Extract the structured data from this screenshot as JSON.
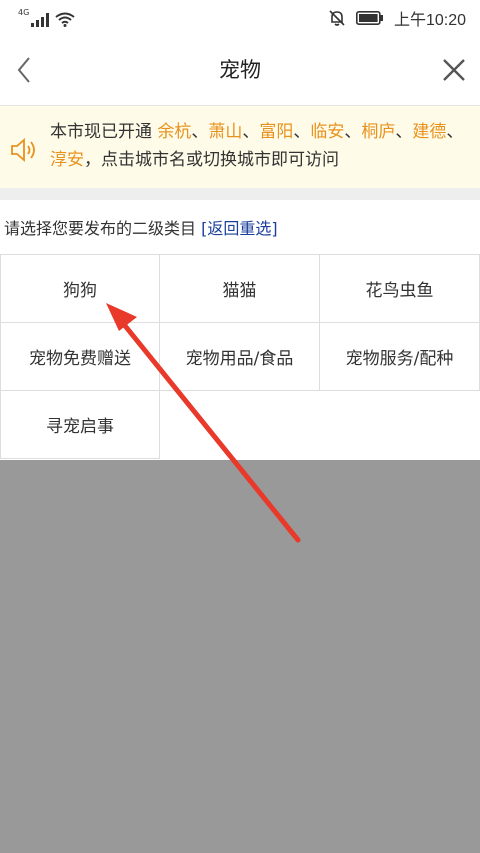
{
  "status_bar": {
    "network": "4G",
    "time": "上午10:20"
  },
  "nav": {
    "title": "宠物"
  },
  "notice": {
    "prefix": "本市现已开通 ",
    "cities": [
      "余杭",
      "萧山",
      "富阳",
      "临安",
      "桐庐",
      "建德",
      "淳安"
    ],
    "separator": "、",
    "suffix": "，点击城市名或切换城市即可访问"
  },
  "prompt": {
    "text": "请选择您要发布的二级类目 ",
    "link": "[返回重选]"
  },
  "categories": [
    "狗狗",
    "猫猫",
    "花鸟虫鱼",
    "宠物免费赠送",
    "宠物用品/食品",
    "宠物服务/配种",
    "寻宠启事"
  ],
  "colors": {
    "city": "#e8921e",
    "link": "#1b3f9a",
    "arrow": "#e8392a",
    "overlay": "#999999"
  }
}
